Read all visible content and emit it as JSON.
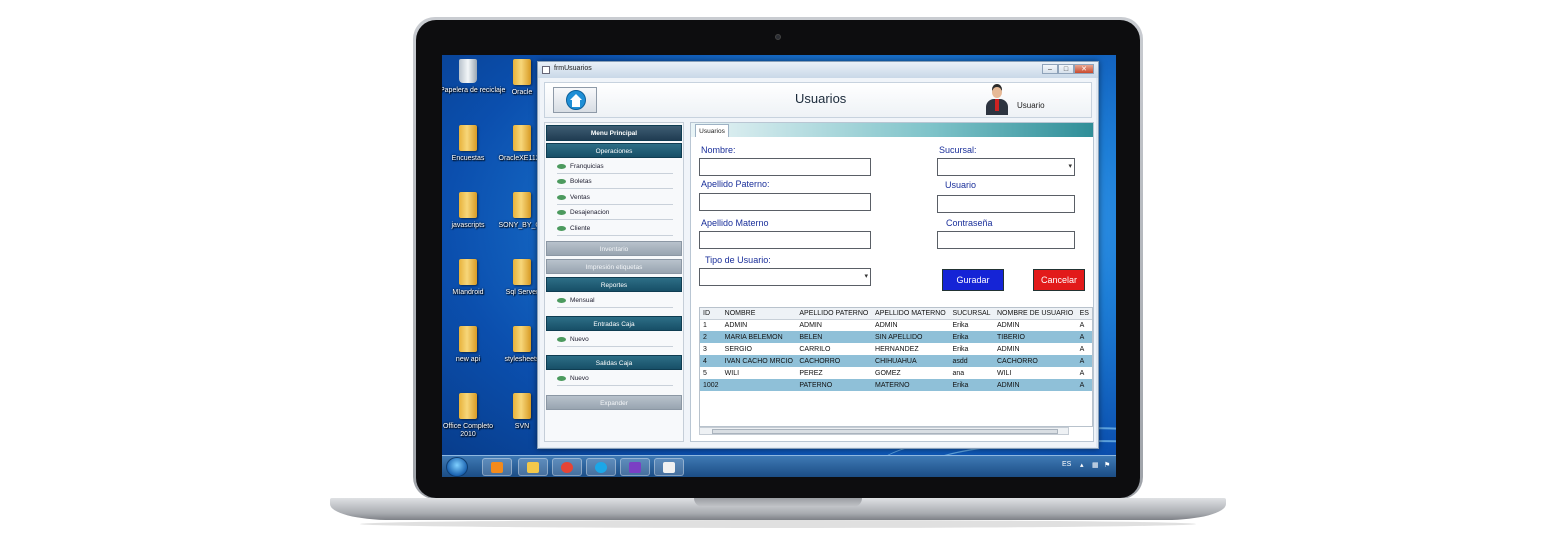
{
  "window": {
    "title": "frmUsuarios"
  },
  "header": {
    "title": "Usuarios",
    "user_label": "Usuario"
  },
  "desktop": {
    "icons": [
      {
        "label": "Papelera de reciclaje",
        "type": "recycle-bin"
      },
      {
        "label": "Oracle",
        "type": "folder"
      },
      {
        "label": "Encuestas",
        "type": "folder"
      },
      {
        "label": "OracleXE112...",
        "type": "folder"
      },
      {
        "label": "javascripts",
        "type": "folder"
      },
      {
        "label": "SONY_BY_OE",
        "type": "folder"
      },
      {
        "label": "MIandroid",
        "type": "folder"
      },
      {
        "label": "Sql Server",
        "type": "folder"
      },
      {
        "label": "new api",
        "type": "folder"
      },
      {
        "label": "stylesheets",
        "type": "folder"
      },
      {
        "label": "Office Completo 2010",
        "type": "folder"
      },
      {
        "label": "SVN",
        "type": "folder"
      }
    ]
  },
  "menu": {
    "title": "Menu Principal",
    "sections": {
      "operaciones": "Operaciones",
      "inventario": "Inventario",
      "impresion": "Impresión etiquetas",
      "reportes": "Reportes",
      "entradas": "Entradas Caja",
      "salidas": "Salidas Caja",
      "expander": "Expander"
    },
    "operaciones_items": [
      "Franquicias",
      "Boletas",
      "Ventas",
      "Desajenacion",
      "Cliente"
    ],
    "reportes_items": [
      "Mensual"
    ],
    "entradas_items": [
      "Nuevo"
    ],
    "salidas_items": [
      "Nuevo"
    ]
  },
  "form": {
    "tab": "Usuarios",
    "nombre_label": "Nombre:",
    "apellido_paterno_label": "Apellido Paterno:",
    "apellido_materno_label": "Apellido Materno",
    "tipo_usuario_label": "Tipo de Usuario:",
    "sucursal_label": "Sucursal:",
    "usuario_label": "Usuario",
    "contrasena_label": "Contraseña",
    "save_label": "Guradar",
    "cancel_label": "Cancelar"
  },
  "colors": {
    "save_button": "#1524d6",
    "cancel_button": "#e21a1a",
    "row_alt": "#8fc0d8",
    "menu_header": "#174f67"
  },
  "table": {
    "columns": [
      "ID",
      "NOMBRE",
      "APELLIDO PATERNO",
      "APELLIDO MATERNO",
      "SUCURSAL",
      "NOMBRE DE USUARIO",
      "ES"
    ],
    "rows": [
      [
        "1",
        "ADMIN",
        "ADMIN",
        "ADMIN",
        "Erika",
        "ADMIN",
        "A"
      ],
      [
        "2",
        "MARIA BELEMON",
        "BELEN",
        "SIN APELLIDO",
        "Erika",
        "TIBERIO",
        "A"
      ],
      [
        "3",
        "SERGIO",
        "CARRILO",
        "HERNANDEZ",
        "Erika",
        "ADMIN",
        "A"
      ],
      [
        "4",
        "IVAN CACHO MRCIO",
        "CACHORRO",
        "CHIHUAHUA",
        "asdd",
        "CACHORRO",
        "A"
      ],
      [
        "5",
        "WILI",
        "PEREZ",
        "GOMEZ",
        "ana",
        "WILI",
        "A"
      ],
      [
        "1002",
        "",
        "PATERNO",
        "MATERNO",
        "Erika",
        "ADMIN",
        "A"
      ]
    ]
  },
  "taskbar": {
    "apps": [
      "media-player-icon",
      "file-explorer-icon",
      "chrome-icon",
      "skype-icon",
      "visual-studio-icon",
      "document-icon"
    ],
    "language": "ES"
  }
}
